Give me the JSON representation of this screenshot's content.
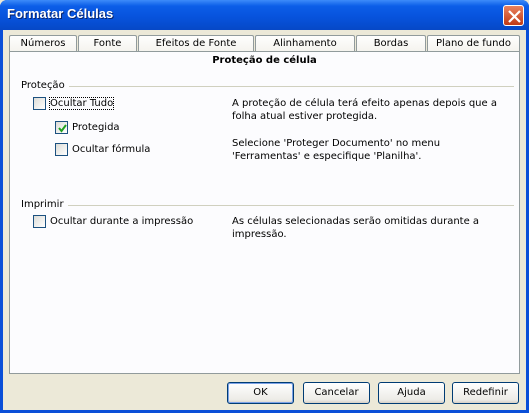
{
  "window": {
    "title": "Formatar Células"
  },
  "tabs": [
    {
      "label": "Números",
      "active": false
    },
    {
      "label": "Fonte",
      "active": false
    },
    {
      "label": "Efeitos de Fonte",
      "active": false
    },
    {
      "label": "Alinhamento",
      "active": false
    },
    {
      "label": "Bordas",
      "active": false
    },
    {
      "label": "Plano de fundo",
      "active": false
    },
    {
      "label": "Proteção de célula",
      "active": true
    }
  ],
  "panel": {
    "title": "Proteção de célula",
    "protection_group": {
      "label": "Proteção",
      "hide_all": {
        "label": "Ocultar Tudo",
        "checked": false
      },
      "protected": {
        "label": "Protegida",
        "checked": true
      },
      "hide_formula": {
        "label": "Ocultar fórmula",
        "checked": false
      },
      "desc1": "A proteção de célula terá efeito apenas depois que a folha atual estiver protegida.",
      "desc2": "Selecione 'Proteger Documento' no menu 'Ferramentas' e especifique 'Planilha'."
    },
    "print_group": {
      "label": "Imprimir",
      "hide_print": {
        "label": "Ocultar durante a impressão",
        "checked": false
      },
      "desc": "As células selecionadas serão omitidas durante a impressão."
    }
  },
  "buttons": {
    "ok": "OK",
    "cancel": "Cancelar",
    "help": "Ajuda",
    "reset": "Redefinir"
  },
  "colors": {
    "titlebar": "#0752db",
    "active_tab_accent": "#ff9c00",
    "check": "#21a121"
  }
}
